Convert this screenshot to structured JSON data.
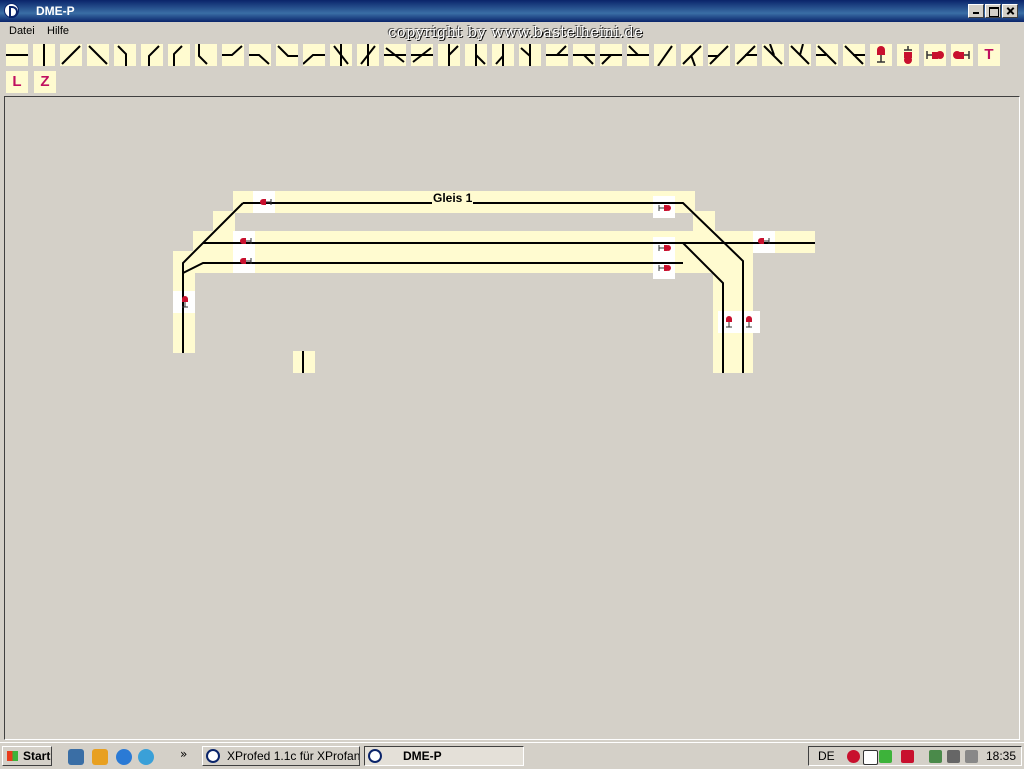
{
  "window": {
    "title": "DME-P"
  },
  "copyright": "copyright by www.bastelheini.de",
  "menu": {
    "items": [
      "Datei",
      "Hilfe"
    ]
  },
  "toolbar": {
    "label_buttons": [
      "T",
      "L",
      "Z"
    ]
  },
  "canvas": {
    "track_label": "Gleis 1"
  },
  "taskbar": {
    "start_label": "Start",
    "tasks": [
      {
        "label": "XProfed 1.1c für XProfan..."
      },
      {
        "label": "DME-P"
      }
    ],
    "tray": {
      "language": "DE",
      "clock": "18:35"
    }
  },
  "colors": {
    "track_bg": "#fffbd0",
    "signal_red": "#c8102e",
    "titlebar": "#0a246a"
  },
  "icons": [
    "app-icon",
    "minimize-icon",
    "maximize-icon",
    "close-icon",
    "signal-icon",
    "windows-logo-icon"
  ]
}
